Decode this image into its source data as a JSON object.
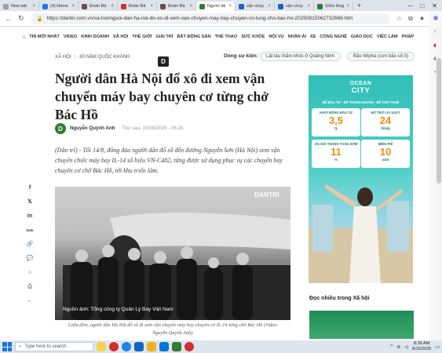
{
  "browser": {
    "tabs": [
      {
        "label": "New tab",
        "color": "#9e9e9e"
      },
      {
        "label": "(4) Home",
        "color": "#1877f2"
      },
      {
        "label": "Đoàn Bả",
        "color": "#6d4c41"
      },
      {
        "label": "Đoàn Bả",
        "color": "#d32f2f"
      },
      {
        "label": "Đoàn Bả",
        "color": "#6d4c41"
      },
      {
        "label": "Người dâ",
        "color": "#2e7d32",
        "active": true
      },
      {
        "label": "vận chuy",
        "color": "#1565c0"
      },
      {
        "label": "vận chuy",
        "color": "#1565c0"
      },
      {
        "label": "Giữa lòng",
        "color": "#2e7d32"
      }
    ],
    "new_tab_symbol": "+",
    "url": "https://dantri.com.vn/xa-hoi/nguoi-dan-ha-noi-do-xo-di-xem-van-chuyen-may-bay-chuyen-co-tung-cho-bac-ho-20250815062732668.htm"
  },
  "sitenav": {
    "items": [
      "TIN MỚI NHẤT",
      "VIDEO",
      "KINH DOANH",
      "XÃ HỘI",
      "THẾ GIỚI",
      "GIẢI TRÍ",
      "BẤT ĐỘNG SẢN",
      "THỂ THAO",
      "SỨC KHỎE",
      "NỘI VỤ",
      "NHÂN ÁI",
      "XE",
      "CÔNG NGHỆ",
      "GIÁO DỤC",
      "VIỆC LÀM",
      "PHÁP LUẬT"
    ]
  },
  "breadcrumb": {
    "section": "XÃ HỘI",
    "separator": "|",
    "subsection": "80 NĂM QUỐC KHÁNH"
  },
  "events": {
    "label": "Dòng sự kiện:",
    "chips": [
      "Lật tàu thăm khóc ở Quảng Ninh",
      "Bão Wipha (cơn bão số 3)"
    ]
  },
  "article": {
    "title": "Người dân Hà Nội đổ xô đi xem vận chuyển máy bay chuyên cơ từng chở Bác Hồ",
    "author_initial": "D",
    "author": "Nguyễn Quỳnh Anh",
    "published": "Thứ sáu, 15/08/2025 - 06:28",
    "sapo": "(Dân trí) - Tối 14/8, đông đảo người dân đổ xô đến đường Nguyễn Sơn (Hà Nội) xem vận chuyển chiếc máy bay IL-14 số hiệu VN-C482, từng được sử dụng phục vụ các chuyến bay chuyên cơ chở Bác Hồ, tới khu triển lãm.",
    "photo_watermark": "DANTRI",
    "photo_credit": "Nguồn ảnh: Tổng công ty Quản Lý Bay Việt Nam",
    "photo_caption": "Giữa đêm, người dân Hà Nội đổ xô đi xem vận chuyển máy bay chuyên cơ IL-14 từng chở Bác Hồ (Video: Nguyễn Quỳnh Anh)."
  },
  "social": {
    "zalo_label": "Zalo"
  },
  "ad": {
    "brand_line1": "OCEAN",
    "brand_line2": "CITY",
    "tagline": "ĐỂ ĐẦU TƯ · ĐỂ THÀNH KHOẢN · ĐỂ CHO THUÊ",
    "boxes": [
      {
        "title": "KHỞI ĐỘNG ĐẦU TƯ",
        "value": "3,5",
        "unit": "tỷ"
      },
      {
        "title": "HỖ TRỢ LÃI SUẤT",
        "value": "24",
        "unit": "tháng"
      },
      {
        "title": "ƯU ĐÃI THANH TOÁN SỚM",
        "value": "11",
        "unit": "%"
      },
      {
        "title": "MIỄN PHÍ",
        "value": "10",
        "unit": "năm"
      }
    ]
  },
  "sidebar": {
    "heading": "Đọc nhiều trong Xã hội"
  },
  "taskbar": {
    "search_placeholder": "Type here to search",
    "time": "8:39 AM",
    "date": "8/15/2025"
  }
}
